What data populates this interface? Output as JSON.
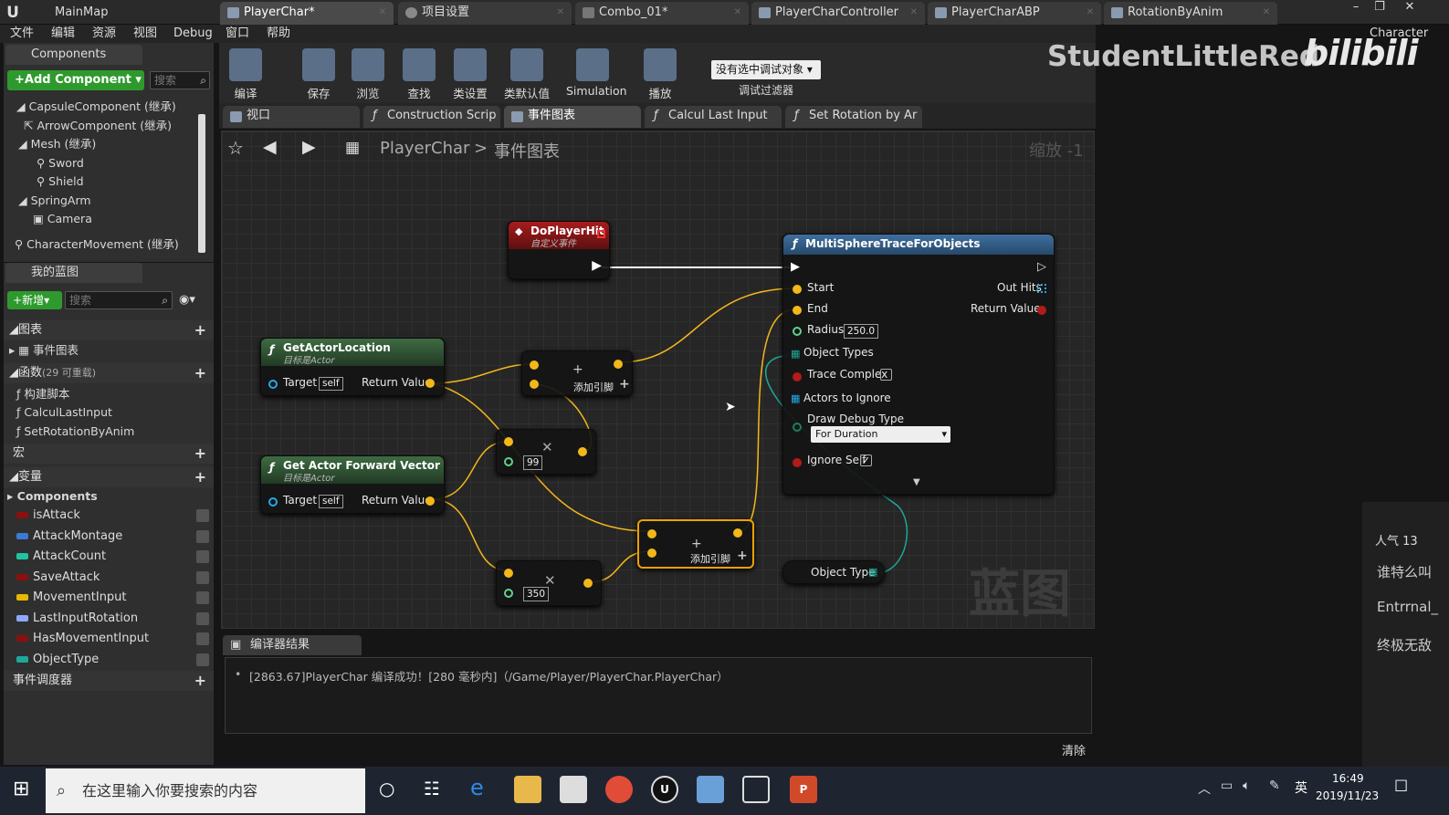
{
  "tabs": [
    {
      "label": "MainMap"
    },
    {
      "label": "PlayerChar*"
    },
    {
      "label": "项目设置"
    },
    {
      "label": "Combo_01*"
    },
    {
      "label": "PlayerCharController"
    },
    {
      "label": "PlayerCharABP"
    },
    {
      "label": "RotationByAnim"
    }
  ],
  "overlay": {
    "watermark": "StudentLittleRed",
    "site": "bilibili",
    "title_right": "Character",
    "stream_popularity": "人气 13",
    "chat": [
      "谁特么叫",
      "Entrrnal_",
      "终极无敌"
    ]
  },
  "menu": [
    "文件",
    "编辑",
    "资源",
    "视图",
    "Debug",
    "窗口",
    "帮助"
  ],
  "components": {
    "tab": "Components",
    "add_button": "+Add Component",
    "search_placeholder": "搜索",
    "tree": [
      "CapsuleComponent (继承)",
      "ArrowComponent (继承)",
      "Mesh (继承)",
      "Sword",
      "Shield",
      "SpringArm",
      "Camera",
      "CharacterMovement (继承)"
    ]
  },
  "myblueprint": {
    "tab": "我的蓝图",
    "new_button": "新增",
    "search_placeholder": "搜索",
    "graphs_header": "图表",
    "graphs_item": "事件图表",
    "functions_header": "函数",
    "functions_count": "(29 可重载)",
    "functions": [
      "构建脚本",
      "CalculLastInput",
      "SetRotationByAnim"
    ],
    "macros_header": "宏",
    "variables_header": "变量",
    "components_header": "Components",
    "variables": [
      {
        "name": "isAttack",
        "color": "#8a1010"
      },
      {
        "name": "AttackMontage",
        "color": "#3a7bd5"
      },
      {
        "name": "AttackCount",
        "color": "#1fc4a0"
      },
      {
        "name": "SaveAttack",
        "color": "#8a1010"
      },
      {
        "name": "MovementInput",
        "color": "#e8b800"
      },
      {
        "name": "LastInputRotation",
        "color": "#8fa8ff"
      },
      {
        "name": "HasMovementInput",
        "color": "#8a1010"
      },
      {
        "name": "ObjectType",
        "color": "#1fa89a"
      }
    ],
    "dispatchers_header": "事件调度器"
  },
  "toolbar": {
    "buttons": [
      {
        "label": "编译",
        "icon": "compile-icon"
      },
      {
        "label": "保存",
        "icon": "save-icon"
      },
      {
        "label": "浏览",
        "icon": "browse-icon"
      },
      {
        "label": "查找",
        "icon": "find-icon"
      },
      {
        "label": "类设置",
        "icon": "class-settings-icon"
      },
      {
        "label": "类默认值",
        "icon": "class-defaults-icon"
      },
      {
        "label": "Simulation",
        "icon": "simulation-icon"
      },
      {
        "label": "播放",
        "icon": "play-icon"
      }
    ],
    "debug_dropdown": "没有选中调试对象",
    "debug_label": "调试过滤器"
  },
  "graph_tabs": [
    {
      "label": "视口"
    },
    {
      "label": "Construction Scrip"
    },
    {
      "label": "事件图表"
    },
    {
      "label": "Calcul Last Input"
    },
    {
      "label": "Set Rotation by Ar"
    }
  ],
  "breadcrumb": {
    "root": "PlayerChar",
    "separator": ">",
    "current": "事件图表",
    "zoom": "缩放 -1"
  },
  "nodes": {
    "doplayerhit": {
      "title": "DoPlayerHit",
      "subtitle": "自定义事件"
    },
    "getactorlocation": {
      "title": "GetActorLocation",
      "subtitle": "目标是Actor",
      "target": "Target",
      "self": "self",
      "ret": "Return Value"
    },
    "getforward": {
      "title": "Get Actor Forward Vector",
      "subtitle": "目标是Actor",
      "target": "Target",
      "self": "self",
      "ret": "Return Value"
    },
    "add1": {
      "label": "添加引脚"
    },
    "add2": {
      "label": "添加引脚"
    },
    "mult1": {
      "value": "99"
    },
    "mult2": {
      "value": "350"
    },
    "trace": {
      "title": "MultiSphereTraceForObjects",
      "start": "Start",
      "end": "End",
      "radius": "Radius",
      "radius_value": "250.0",
      "object_types": "Object Types",
      "trace_complex": "Trace Complex",
      "actors_ignore": "Actors to Ignore",
      "draw_debug": "Draw Debug Type",
      "draw_debug_value": "For Duration",
      "ignore_self": "Ignore Self",
      "out_hits": "Out Hits",
      "return_value": "Return Value"
    },
    "objecttype": {
      "label": "Object Type"
    }
  },
  "graph_watermark": "蓝图",
  "output": {
    "tab": "编译器结果",
    "log": "[2863.67]PlayerChar 编译成功！[280 毫秒内]（/Game/Player/PlayerChar.PlayerChar）",
    "clear": "清除"
  },
  "taskbar": {
    "search_placeholder": "在这里输入你要搜索的内容",
    "ime": "英",
    "time": "16:49",
    "date": "2019/11/23"
  }
}
